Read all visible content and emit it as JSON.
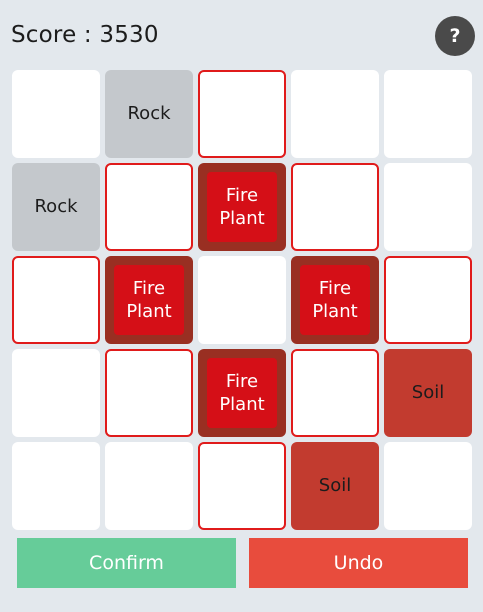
{
  "header": {
    "score_text": "Score : 3530",
    "help_label": "?"
  },
  "board": {
    "rows": 5,
    "cols": 5,
    "highlight_color": "#e01b1b",
    "cells": [
      {
        "type": "empty",
        "label": "",
        "highlighted": false
      },
      {
        "type": "rock",
        "label": "Rock",
        "highlighted": false
      },
      {
        "type": "empty",
        "label": "",
        "highlighted": true
      },
      {
        "type": "empty",
        "label": "",
        "highlighted": false
      },
      {
        "type": "empty",
        "label": "",
        "highlighted": false
      },
      {
        "type": "rock",
        "label": "Rock",
        "highlighted": false
      },
      {
        "type": "empty",
        "label": "",
        "highlighted": true
      },
      {
        "type": "fireplant",
        "label": "Fire Plant",
        "highlighted": false
      },
      {
        "type": "empty",
        "label": "",
        "highlighted": true
      },
      {
        "type": "empty",
        "label": "",
        "highlighted": false
      },
      {
        "type": "empty",
        "label": "",
        "highlighted": true
      },
      {
        "type": "fireplant",
        "label": "Fire Plant",
        "highlighted": false
      },
      {
        "type": "empty",
        "label": "",
        "highlighted": false
      },
      {
        "type": "fireplant",
        "label": "Fire Plant",
        "highlighted": false
      },
      {
        "type": "empty",
        "label": "",
        "highlighted": true
      },
      {
        "type": "empty",
        "label": "",
        "highlighted": false
      },
      {
        "type": "empty",
        "label": "",
        "highlighted": true
      },
      {
        "type": "fireplant",
        "label": "Fire Plant",
        "highlighted": false
      },
      {
        "type": "empty",
        "label": "",
        "highlighted": true
      },
      {
        "type": "soil",
        "label": "Soil",
        "highlighted": false
      },
      {
        "type": "empty",
        "label": "",
        "highlighted": false
      },
      {
        "type": "empty",
        "label": "",
        "highlighted": false
      },
      {
        "type": "empty",
        "label": "",
        "highlighted": true
      },
      {
        "type": "soil",
        "label": "Soil",
        "highlighted": false
      },
      {
        "type": "empty",
        "label": "",
        "highlighted": false
      }
    ]
  },
  "actions": {
    "confirm_label": "Confirm",
    "undo_label": "Undo",
    "confirm_color": "#66cc99",
    "undo_color": "#e84c3d"
  },
  "colors": {
    "background": "#e3e8ed",
    "rock": "#c4c8cc",
    "soil": "#c23b2f",
    "fireplant_outer": "#992f22",
    "fireplant_inner": "#d50f17"
  }
}
